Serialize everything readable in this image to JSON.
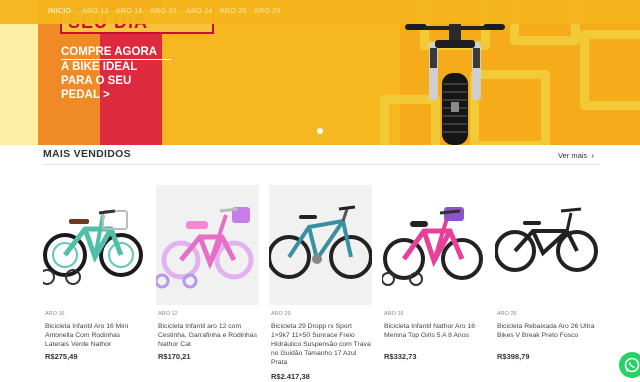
{
  "nav": {
    "items": [
      "INICIO",
      "ARO 12",
      "ARO 16",
      "ARO 20",
      "ARO 24",
      "ARO 26",
      "ARO 29"
    ],
    "active_index": 0
  },
  "hero": {
    "title": "SEU DIA",
    "tagline_line1": "COMPRE AGORA",
    "tagline_rest": "A BIKE IDEAL PARA O SEU PEDAL >",
    "colors": {
      "orange": "#f08a26",
      "red": "#dd2a3f",
      "yellow": "#f6b51c"
    }
  },
  "section": {
    "title": "MAIS VENDIDOS",
    "see_more": "Ver mais"
  },
  "products": [
    {
      "category": "ARO 16",
      "name": "Bicicleta Infantil Aro 16 Mini Antonella Com Rodinhas Laterais Verde Nathor",
      "price": "R$275,49",
      "icon": "kids-bike-teal"
    },
    {
      "category": "ARO 12",
      "name": "Bicicleta Infantil aro 12 com Cestinha, Garrafinha e Rodinhas Nathor Cat",
      "price": "R$170,21",
      "icon": "kids-bike-pink"
    },
    {
      "category": "ARO 29",
      "name": "Bicicleta 29 Dropp rx Sport 1×9k7 11×50 Sunrace Freio Hidráulico Suspensão com Trava no Guidão Tamanho 17 Azul Prata",
      "price": "R$2.417,38",
      "icon": "mountain-bike"
    },
    {
      "category": "ARO 16",
      "name": "Bicicleta Infantil Nathor Aro 16 Menina Top Girls 5 A 8 Anos",
      "price": "R$332,73",
      "icon": "girls-bike-pink"
    },
    {
      "category": "ARO 26",
      "name": "Bicicleta Rebaixada Aro 26 Ultra Bikes V Break Preto Fosco",
      "price": "R$398,79",
      "icon": "bmx-bike-black"
    }
  ],
  "whatsapp": {
    "icon": "whatsapp-icon",
    "color": "#25d366"
  }
}
